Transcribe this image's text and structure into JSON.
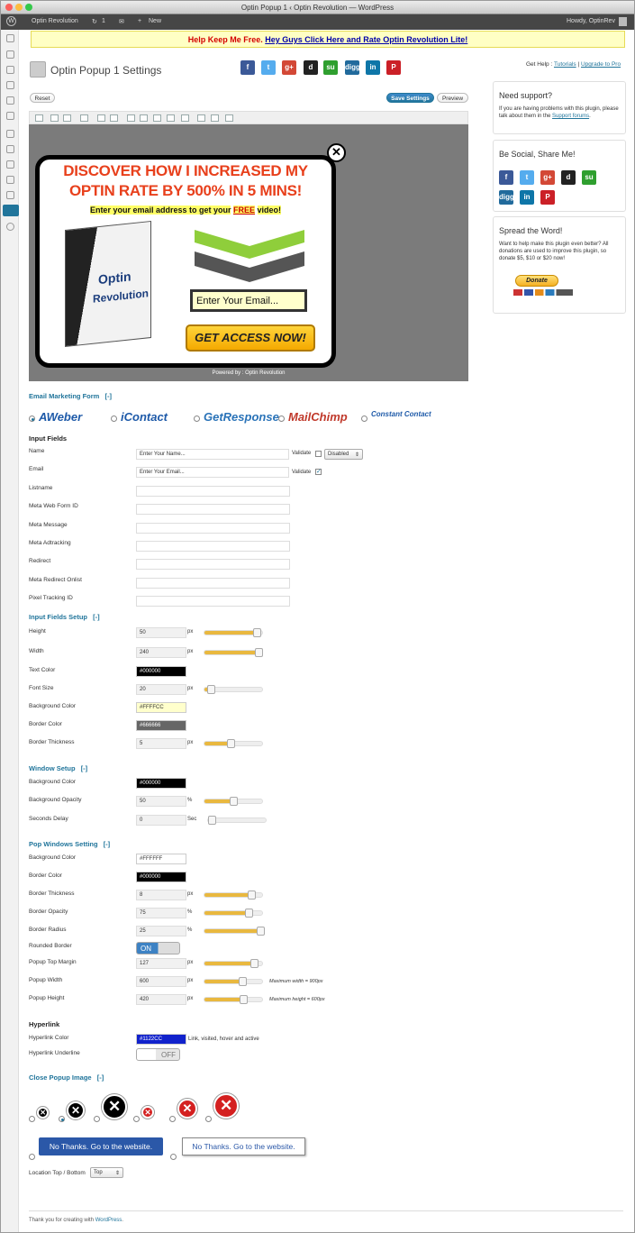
{
  "window": {
    "title": "Optin Popup 1 ‹ Optin Revolution — WordPress"
  },
  "adminbar": {
    "site": "Optin Revolution",
    "updates": "1",
    "new": "New",
    "howdy": "Howdy, OptinRev"
  },
  "notice": {
    "red": "Help Keep Me Free.",
    "link": "Hey Guys Click Here and Rate Optin Revolution Lite!"
  },
  "page": {
    "title": "Optin Popup 1 Settings",
    "help": "Get Help :",
    "tutorials": "Tutorials",
    "sep": "|",
    "upgrade": "Upgrade to Pro",
    "reset": "Reset",
    "save": "Save Settings",
    "preview": "Preview"
  },
  "social": [
    "f",
    "t",
    "g+",
    "d",
    "su",
    "digg",
    "in",
    "P"
  ],
  "colors": {
    "facebook": "#3b5998",
    "twitter": "#55acee",
    "gplus": "#d34836",
    "delicious": "#222222",
    "stumble": "#2f9f2f",
    "digg": "#216a9c",
    "linkedin": "#0e76a8",
    "pinterest": "#cb2027",
    "accent": "#21759b"
  },
  "popup": {
    "headline1": "DISCOVER HOW I INCREASED MY",
    "headline2": "OPTIN RATE BY 500% IN 5 MINS!",
    "sub1": "Enter your email address to get your",
    "sub2": "FREE",
    "sub3": "video!",
    "email_placeholder": "Enter Your Email...",
    "cta": "GET ACCESS NOW!",
    "box1": "Optin",
    "box2": "Revolution",
    "powered": "Powered by : Optin Revolution"
  },
  "form": {
    "email_marketing": "Email Marketing Form",
    "toggle": "[-]",
    "providers": [
      "AWeber",
      "iContact",
      "GetResponse",
      "MailChimp",
      "Constant Contact"
    ],
    "input_fields": "Input Fields",
    "fields": [
      {
        "label": "Name",
        "value": "Enter Your Name..."
      },
      {
        "label": "Email",
        "value": "Enter Your Email..."
      },
      {
        "label": "Listname",
        "value": ""
      },
      {
        "label": "Meta Web Form ID",
        "value": ""
      },
      {
        "label": "Meta Message",
        "value": ""
      },
      {
        "label": "Meta Adtracking",
        "value": ""
      },
      {
        "label": "Redirect",
        "value": ""
      },
      {
        "label": "Meta Redirect Onlist",
        "value": ""
      },
      {
        "label": "Pixel Tracking ID",
        "value": ""
      }
    ],
    "validate": "Validate",
    "disabled": "Disabled",
    "setup": "Input Fields Setup",
    "height": {
      "label": "Height",
      "value": "50",
      "unit": "px",
      "level": 0.9
    },
    "width": {
      "label": "Width",
      "value": "240",
      "unit": "px",
      "level": 0.92
    },
    "text_color": {
      "label": "Text Color",
      "value": "#000000"
    },
    "font_size": {
      "label": "Font Size",
      "value": "20",
      "unit": "px",
      "level": 0.12
    },
    "bg_color": {
      "label": "Background Color",
      "value": "#FFFFCC"
    },
    "border_color": {
      "label": "Border Color",
      "value": "#666666"
    },
    "border_thickness": {
      "label": "Border Thickness",
      "value": "5",
      "unit": "px",
      "level": 0.45
    },
    "window_setup": "Window Setup",
    "win_bg": {
      "label": "Background Color",
      "value": "#000000"
    },
    "win_opacity": {
      "label": "Background Opacity",
      "value": "50",
      "unit": "%",
      "level": 0.5
    },
    "win_delay": {
      "label": "Seconds Delay",
      "value": "0",
      "unit": "Sec",
      "level": 0.02
    },
    "pop_setting": "Pop Windows Setting",
    "pop_bg": {
      "label": "Background Color",
      "value": "#FFFFFF"
    },
    "pop_border": {
      "label": "Border Color",
      "value": "#000000"
    },
    "pop_thick": {
      "label": "Border Thickness",
      "value": "8",
      "unit": "px",
      "level": 0.8
    },
    "pop_opacity": {
      "label": "Border Opacity",
      "value": "75",
      "unit": "%",
      "level": 0.75
    },
    "pop_radius": {
      "label": "Border Radius",
      "value": "25",
      "unit": "%",
      "level": 0.95
    },
    "rounded": {
      "label": "Rounded Border",
      "state": "ON"
    },
    "margin": {
      "label": "Popup Top Margin",
      "value": "127",
      "unit": "px",
      "level": 0.85
    },
    "pwidth": {
      "label": "Popup Width",
      "value": "600",
      "unit": "px",
      "level": 0.65,
      "note": "Maximum width = 900px"
    },
    "pheight": {
      "label": "Popup Height",
      "value": "420",
      "unit": "px",
      "level": 0.67,
      "note": "Maximum height = 600px"
    },
    "hyperlink": "Hyperlink",
    "hl_color": {
      "label": "Hyperlink Color",
      "value": "#1122CC",
      "note": "Link, visited, hover and active"
    },
    "hl_underline": {
      "label": "Hyperlink Underline",
      "state": "OFF"
    },
    "close_image": "Close Popup Image",
    "nothanks1": "No Thanks. Go to the website.",
    "nothanks2": "No Thanks. Go to the website.",
    "location": {
      "label": "Location Top / Bottom",
      "value": "Top"
    }
  },
  "sidebar": {
    "support_title": "Need support?",
    "support_text": "If you are having problems with this plugin, please talk about them in the",
    "support_link": "Support forums",
    "social_title": "Be Social, Share Me!",
    "spread_title": "Spread the Word!",
    "spread_text": "Want to help make this plugin even better? All donations are used to improve this plugin, so donate $5, $10 or $20 now!",
    "donate": "Donate"
  },
  "footer": {
    "text": "Thank you for creating with",
    "link": "WordPress",
    "end": "."
  }
}
